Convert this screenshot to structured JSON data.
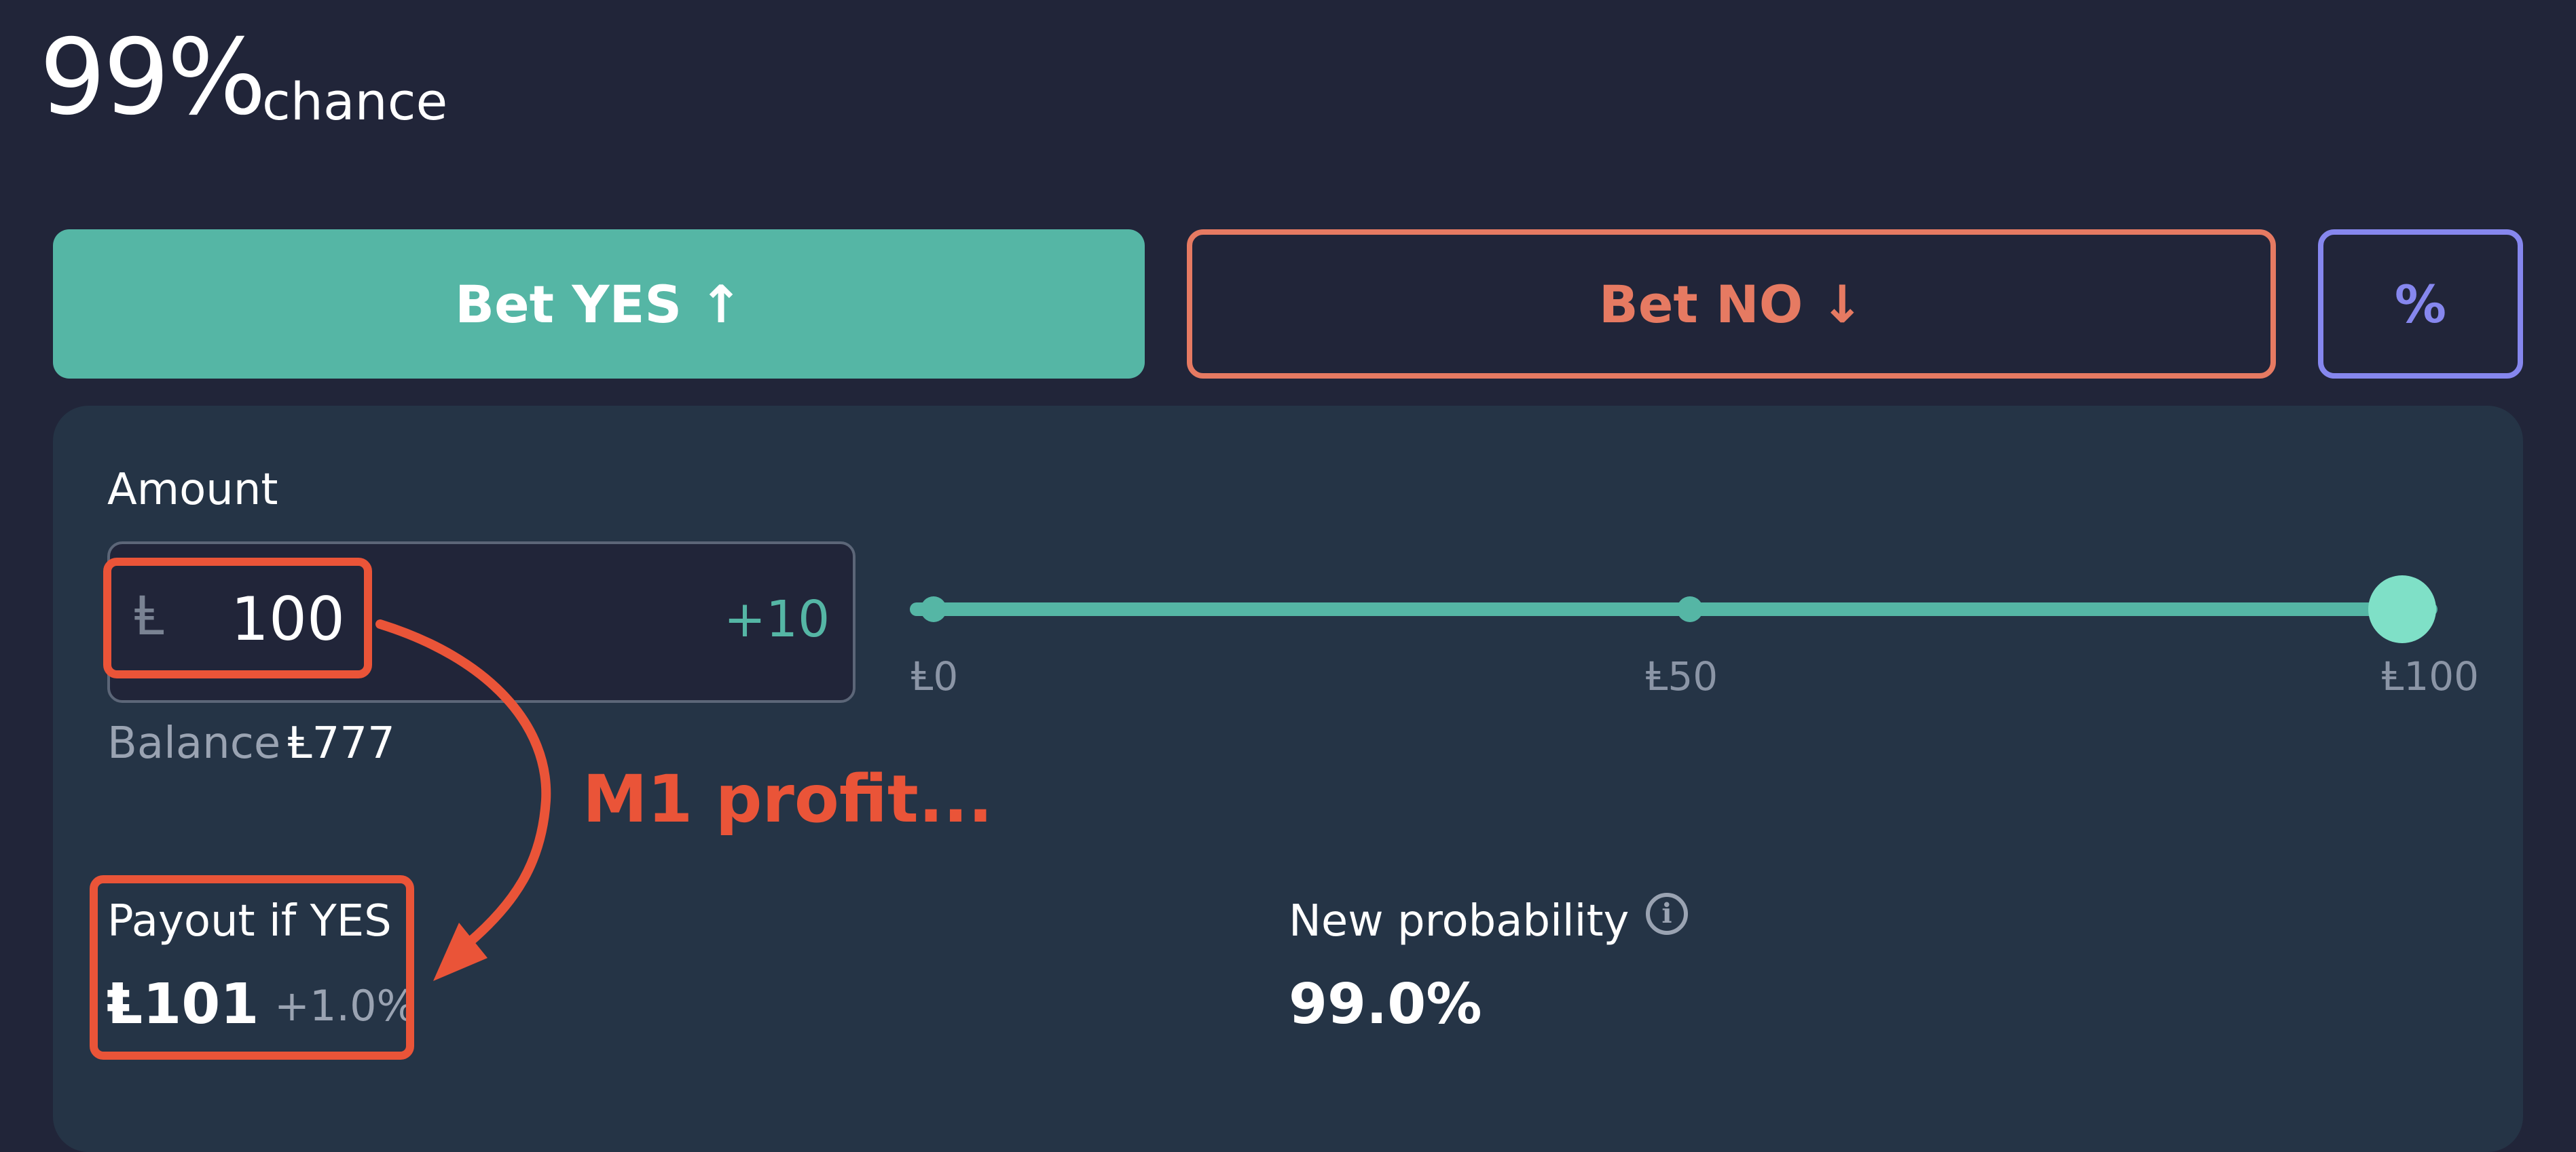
{
  "header": {
    "probability": "99%",
    "probability_label": "chance"
  },
  "buttons": {
    "yes_label": "Bet YES",
    "yes_arrow": "↑",
    "no_label": "Bet NO",
    "no_arrow": "↓",
    "percent_label": "%"
  },
  "amount": {
    "label": "Amount",
    "currency_symbol": "Ⱡ",
    "value": "100",
    "increment_label": "+10",
    "balance_label": "Balance",
    "balance_value": "Ⱡ777"
  },
  "slider": {
    "min_label": "Ⱡ0",
    "mid_label": "Ⱡ50",
    "max_label": "Ⱡ100",
    "current_value": 100,
    "min": 0,
    "max": 100
  },
  "annotation": {
    "text": "M1 profit..."
  },
  "payout": {
    "label": "Payout if YES",
    "value": "Ⱡ101",
    "change": "+1.0%"
  },
  "new_probability": {
    "label": "New probability",
    "value": "99.0%"
  },
  "icons": {
    "yes_arrow_icon": "arrow-up-icon",
    "no_arrow_icon": "arrow-down-icon",
    "info_icon": "info-icon"
  },
  "colors": {
    "background": "#212539",
    "panel": "#253446",
    "yes": "#55b6a5",
    "no": "#e67a62",
    "percent": "#8687ee",
    "annotation": "#ea5438",
    "slider_thumb": "#7fe0c7"
  }
}
